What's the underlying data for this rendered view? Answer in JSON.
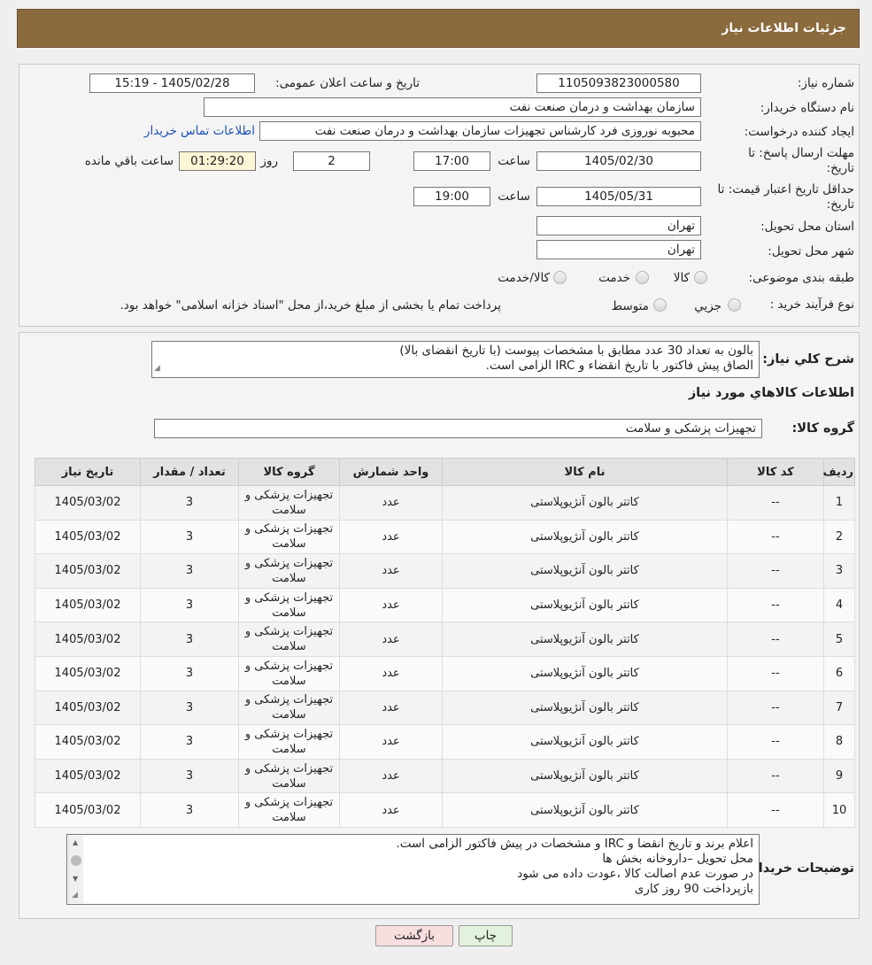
{
  "window_title": "جزئیات اطلاعات نیاز",
  "header": {
    "need_number_label": "شماره نیاز:",
    "need_number": "1105093823000580",
    "announce_label": "تاریخ و ساعت اعلان عمومی:",
    "announce_value": "1405/02/28 - 15:19",
    "buyer_org_label": "نام دستگاه خریدار:",
    "buyer_org": "سازمان بهداشت و درمان صنعت نفت",
    "creator_label": "ایجاد کننده درخواست:",
    "creator": "محبوبه نوروزی فرد کارشناس تجهیزات سازمان بهداشت و درمان صنعت نفت",
    "contact_link": "اطلاعات تماس خریدار",
    "deadline_label": "مهلت ارسال پاسخ: تا تاریخ:",
    "deadline_date": "1405/02/30",
    "time_label": "ساعت",
    "deadline_time": "17:00",
    "days": "2",
    "days_label": "روز و",
    "remaining": "01:29:20",
    "remaining_label": "ساعت باقي مانده",
    "validity_label": "حداقل تاریخ اعتبار قیمت: تا تاریخ:",
    "validity_date": "1405/05/31",
    "validity_time": "19:00",
    "province_label": "استان محل تحویل:",
    "province": "تهران",
    "city_label": "شهر محل تحویل:",
    "city": "تهران",
    "category_label": "طبقه بندی موضوعی:",
    "category_options": [
      "کالا",
      "خدمت",
      "کالا/خدمت"
    ],
    "process_label": "نوع فرآیند خرید :",
    "process_options": [
      "جزیي",
      "متوسط"
    ],
    "process_note": "پرداخت تمام یا بخشی از مبلغ خرید،از محل \"اسناد خزانه اسلامی\" خواهد بود."
  },
  "description": {
    "label": "شرح کلي نیاز:",
    "lines": [
      "بالون به تعداد 30 عدد مطابق با مشخصات پیوست (با تاریخ انقضای بالا)",
      "الصاق پیش فاکتور با تاریخ انقضاء و IRC الزامی است."
    ]
  },
  "goods_section_title": "اطلاعات کالاهاي مورد نیاز",
  "goods_group_label": "گروه کالا:",
  "goods_group": "تجهیزات پزشکی و سلامت",
  "table": {
    "headers": [
      "ردیف",
      "کد کالا",
      "نام کالا",
      "واحد شمارش",
      "گروه کالا",
      "تعداد / مقدار",
      "تاریخ نیاز"
    ],
    "rows": [
      [
        "1",
        "--",
        "کاتتر بالون آنژیوپلاستی",
        "عدد",
        "تجهیزات پزشکی و سلامت",
        "3",
        "1405/03/02"
      ],
      [
        "2",
        "--",
        "کاتتر بالون آنژیوپلاستی",
        "عدد",
        "تجهیزات پزشکی و سلامت",
        "3",
        "1405/03/02"
      ],
      [
        "3",
        "--",
        "کاتتر بالون آنژیوپلاستی",
        "عدد",
        "تجهیزات پزشکی و سلامت",
        "3",
        "1405/03/02"
      ],
      [
        "4",
        "--",
        "کاتتر بالون آنژیوپلاستی",
        "عدد",
        "تجهیزات پزشکی و سلامت",
        "3",
        "1405/03/02"
      ],
      [
        "5",
        "--",
        "کاتتر بالون آنژیوپلاستی",
        "عدد",
        "تجهیزات پزشکی و سلامت",
        "3",
        "1405/03/02"
      ],
      [
        "6",
        "--",
        "کاتتر بالون آنژیوپلاستی",
        "عدد",
        "تجهیزات پزشکی و سلامت",
        "3",
        "1405/03/02"
      ],
      [
        "7",
        "--",
        "کاتتر بالون آنژیوپلاستی",
        "عدد",
        "تجهیزات پزشکی و سلامت",
        "3",
        "1405/03/02"
      ],
      [
        "8",
        "--",
        "کاتتر بالون آنژیوپلاستی",
        "عدد",
        "تجهیزات پزشکی و سلامت",
        "3",
        "1405/03/02"
      ],
      [
        "9",
        "--",
        "کاتتر بالون آنژیوپلاستی",
        "عدد",
        "تجهیزات پزشکی و سلامت",
        "3",
        "1405/03/02"
      ],
      [
        "10",
        "--",
        "کاتتر بالون آنژیوپلاستی",
        "عدد",
        "تجهیزات پزشکی و سلامت",
        "3",
        "1405/03/02"
      ]
    ]
  },
  "buyer_notes": {
    "label": "توضیحات خریدار:",
    "lines": [
      "اعلام برند و تاریخ انقضا  و IRC  و مشخصات در پیش فاکتور الزامی است.",
      "محل تحویل –داروخانه بخش ها",
      "در صورت عدم اصالت کالا ،عودت داده می شود",
      "بازپرداخت 90 روز کاری"
    ]
  },
  "buttons": {
    "print": "چاپ",
    "back": "بازگشت"
  },
  "colors": {
    "titlebar": "#8b6a3e",
    "print_button": "#e3f2dc",
    "back_button": "#f8dede",
    "link": "#1a4fb5"
  }
}
